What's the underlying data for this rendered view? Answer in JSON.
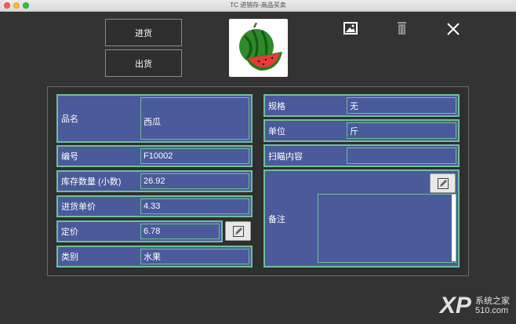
{
  "window": {
    "title": "TC 进销存-商品买卖"
  },
  "toolbar": {
    "stock_in_label": "进货",
    "stock_out_label": "出货"
  },
  "fields": {
    "name": {
      "label": "品名",
      "value": "西瓜"
    },
    "code": {
      "label": "编号",
      "value": "F10002"
    },
    "quantity": {
      "label": "库存数量 (小数)",
      "value": "26.92"
    },
    "cost": {
      "label": "进货单价",
      "value": "4.33"
    },
    "price": {
      "label": "定价",
      "value": "6.78"
    },
    "category": {
      "label": "类别",
      "value": "水果"
    },
    "spec": {
      "label": "规格",
      "value": "无"
    },
    "unit": {
      "label": "单位",
      "value": "斤"
    },
    "scan": {
      "label": "扫瞄内容",
      "value": ""
    },
    "note": {
      "label": "备注",
      "value": ""
    }
  },
  "watermark": {
    "brand": "XP",
    "sub_top": "系统之家",
    "sub_bottom": "510.com"
  },
  "icons": {
    "image": "image-icon",
    "trash": "trash-icon",
    "close": "close-icon",
    "edit": "edit-icon"
  },
  "colors": {
    "background": "#333333",
    "field_bg": "#4a5a9a",
    "field_border": "#6fbf9a"
  }
}
